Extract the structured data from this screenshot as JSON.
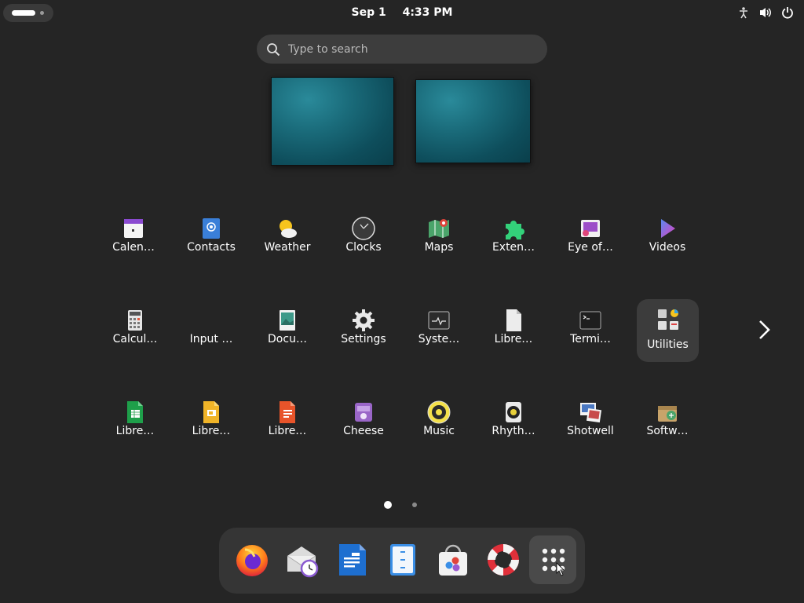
{
  "topbar": {
    "date": "Sep 1",
    "time": "4:33 PM",
    "tray_icons": [
      "accessibility-icon",
      "volume-icon",
      "power-icon"
    ]
  },
  "search": {
    "placeholder": "Type to search"
  },
  "apps": {
    "row1": [
      {
        "label": "Calen…",
        "icon": "calendar-icon"
      },
      {
        "label": "Contacts",
        "icon": "contacts-icon"
      },
      {
        "label": "Weather",
        "icon": "weather-icon"
      },
      {
        "label": "Clocks",
        "icon": "clocks-icon"
      },
      {
        "label": "Maps",
        "icon": "maps-icon"
      },
      {
        "label": "Exten…",
        "icon": "extensions-icon"
      },
      {
        "label": "Eye of…",
        "icon": "image-viewer-icon"
      },
      {
        "label": "Videos",
        "icon": "videos-icon"
      }
    ],
    "row2": [
      {
        "label": "Calcul…",
        "icon": "calculator-icon"
      },
      {
        "label": "Input …",
        "icon": "input-method-icon"
      },
      {
        "label": "Docu…",
        "icon": "document-viewer-icon"
      },
      {
        "label": "Settings",
        "icon": "settings-icon"
      },
      {
        "label": "Syste…",
        "icon": "system-monitor-icon"
      },
      {
        "label": "Libre…",
        "icon": "libreoffice-icon"
      },
      {
        "label": "Termi…",
        "icon": "terminal-icon"
      },
      {
        "label": "Utilities",
        "icon": "utilities-folder-icon"
      }
    ],
    "row3": [
      {
        "label": "Libre…",
        "icon": "libreoffice-calc-icon"
      },
      {
        "label": "Libre…",
        "icon": "libreoffice-impress-icon"
      },
      {
        "label": "Libre…",
        "icon": "libreoffice-draw-icon"
      },
      {
        "label": "Cheese",
        "icon": "cheese-icon"
      },
      {
        "label": "Music",
        "icon": "music-icon"
      },
      {
        "label": "Rhyth…",
        "icon": "rhythmbox-icon"
      },
      {
        "label": "Shotwell",
        "icon": "shotwell-icon"
      },
      {
        "label": "Softw…",
        "icon": "software-icon"
      }
    ]
  },
  "pager": {
    "pages": 2,
    "current": 1
  },
  "dock": {
    "items": [
      "firefox-icon",
      "mail-clock-icon",
      "libreoffice-writer-icon",
      "files-icon",
      "software-store-icon",
      "help-icon",
      "show-apps-icon"
    ]
  },
  "colors": {
    "background": "#252525",
    "panel": "#353535",
    "accent": "#3584e4"
  }
}
